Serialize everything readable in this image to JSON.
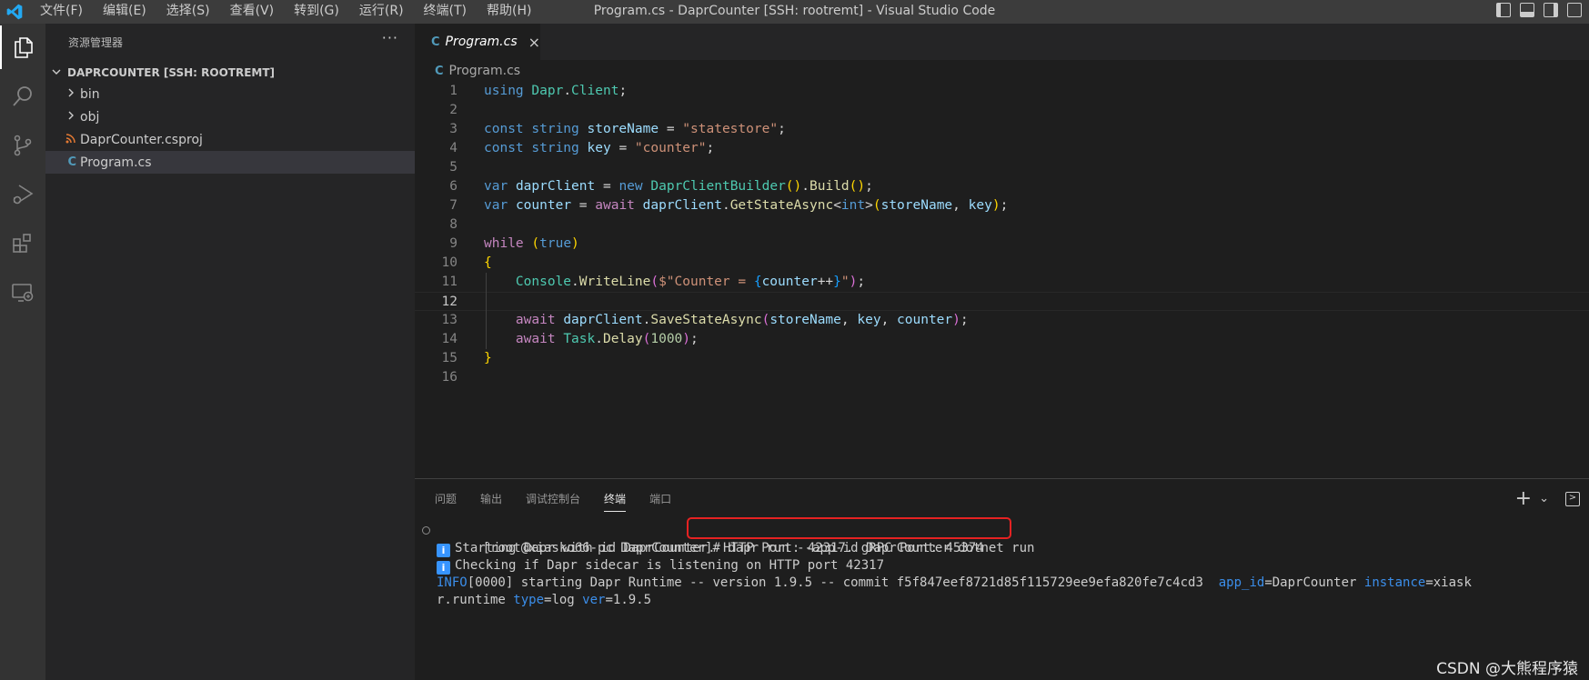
{
  "titlebar": {
    "menus": [
      "文件(F)",
      "编辑(E)",
      "选择(S)",
      "查看(V)",
      "转到(G)",
      "运行(R)",
      "终端(T)",
      "帮助(H)"
    ],
    "title": "Program.cs - DaprCounter [SSH: rootremt] - Visual Studio Code"
  },
  "activitybar": [
    "explorer-icon",
    "search-icon",
    "source-control-icon",
    "run-debug-icon",
    "extensions-icon",
    "remote-explorer-icon"
  ],
  "sidebar": {
    "header": "资源管理器",
    "more": "···",
    "section": "DAPRCOUNTER [SSH: ROOTREMT]",
    "items": [
      {
        "label": "bin",
        "type": "folder"
      },
      {
        "label": "obj",
        "type": "folder"
      },
      {
        "label": "DaprCounter.csproj",
        "type": "rss-file"
      },
      {
        "label": "Program.cs",
        "type": "csharp-file",
        "selected": true
      }
    ]
  },
  "editor": {
    "tab_label": "Program.cs",
    "tab_close": "×",
    "breadcrumb": "Program.cs",
    "current_line": 12,
    "line_numbers": [
      "1",
      "2",
      "3",
      "4",
      "5",
      "6",
      "7",
      "8",
      "9",
      "10",
      "11",
      "12",
      "13",
      "14",
      "15",
      "16"
    ]
  },
  "panel": {
    "tabs": [
      "问题",
      "输出",
      "调试控制台",
      "终端",
      "端口"
    ],
    "active_tab": "终端",
    "actions": {
      "add": "+",
      "dropdown": "⌄",
      "toggle": "⊡"
    },
    "terminal": {
      "prompt": "[root@xiasko66-pc DaprCounter]# ",
      "command": "dapr run --app-id DaprCounter dotnet run",
      "info1": "Starting Dapr with id DaprCounter. HTTP Port: 42317. gRPC Port: 45374",
      "info2": "Checking if Dapr sidecar is listening on HTTP port 42317",
      "log_prefix": "INFO",
      "log_rest": "[0000] starting Dapr Runtime -- version 1.9.5 -- commit f5f847eef8721d85f115729ee9efa820fe7c4cd3  ",
      "kv_app_id_key": "app_id",
      "kv_app_id_val": "=DaprCounter ",
      "kv_instance_key": "instance",
      "kv_instance_val": "=xiask",
      "wrap_prefix": "r.runtime ",
      "kv_type_key": "type",
      "kv_type_val": "=log ",
      "kv_ver_key": "ver",
      "kv_ver_val": "=1.9.5"
    }
  },
  "watermark": "CSDN @大熊程序猿",
  "colors": {
    "titlebar": "#3c3c3c",
    "activitybar": "#333333",
    "sidebar": "#252526",
    "editor": "#1e1e1e",
    "highlight_box": "#e62222",
    "csharp_icon": "#519aba",
    "rss_icon": "#e37933"
  }
}
